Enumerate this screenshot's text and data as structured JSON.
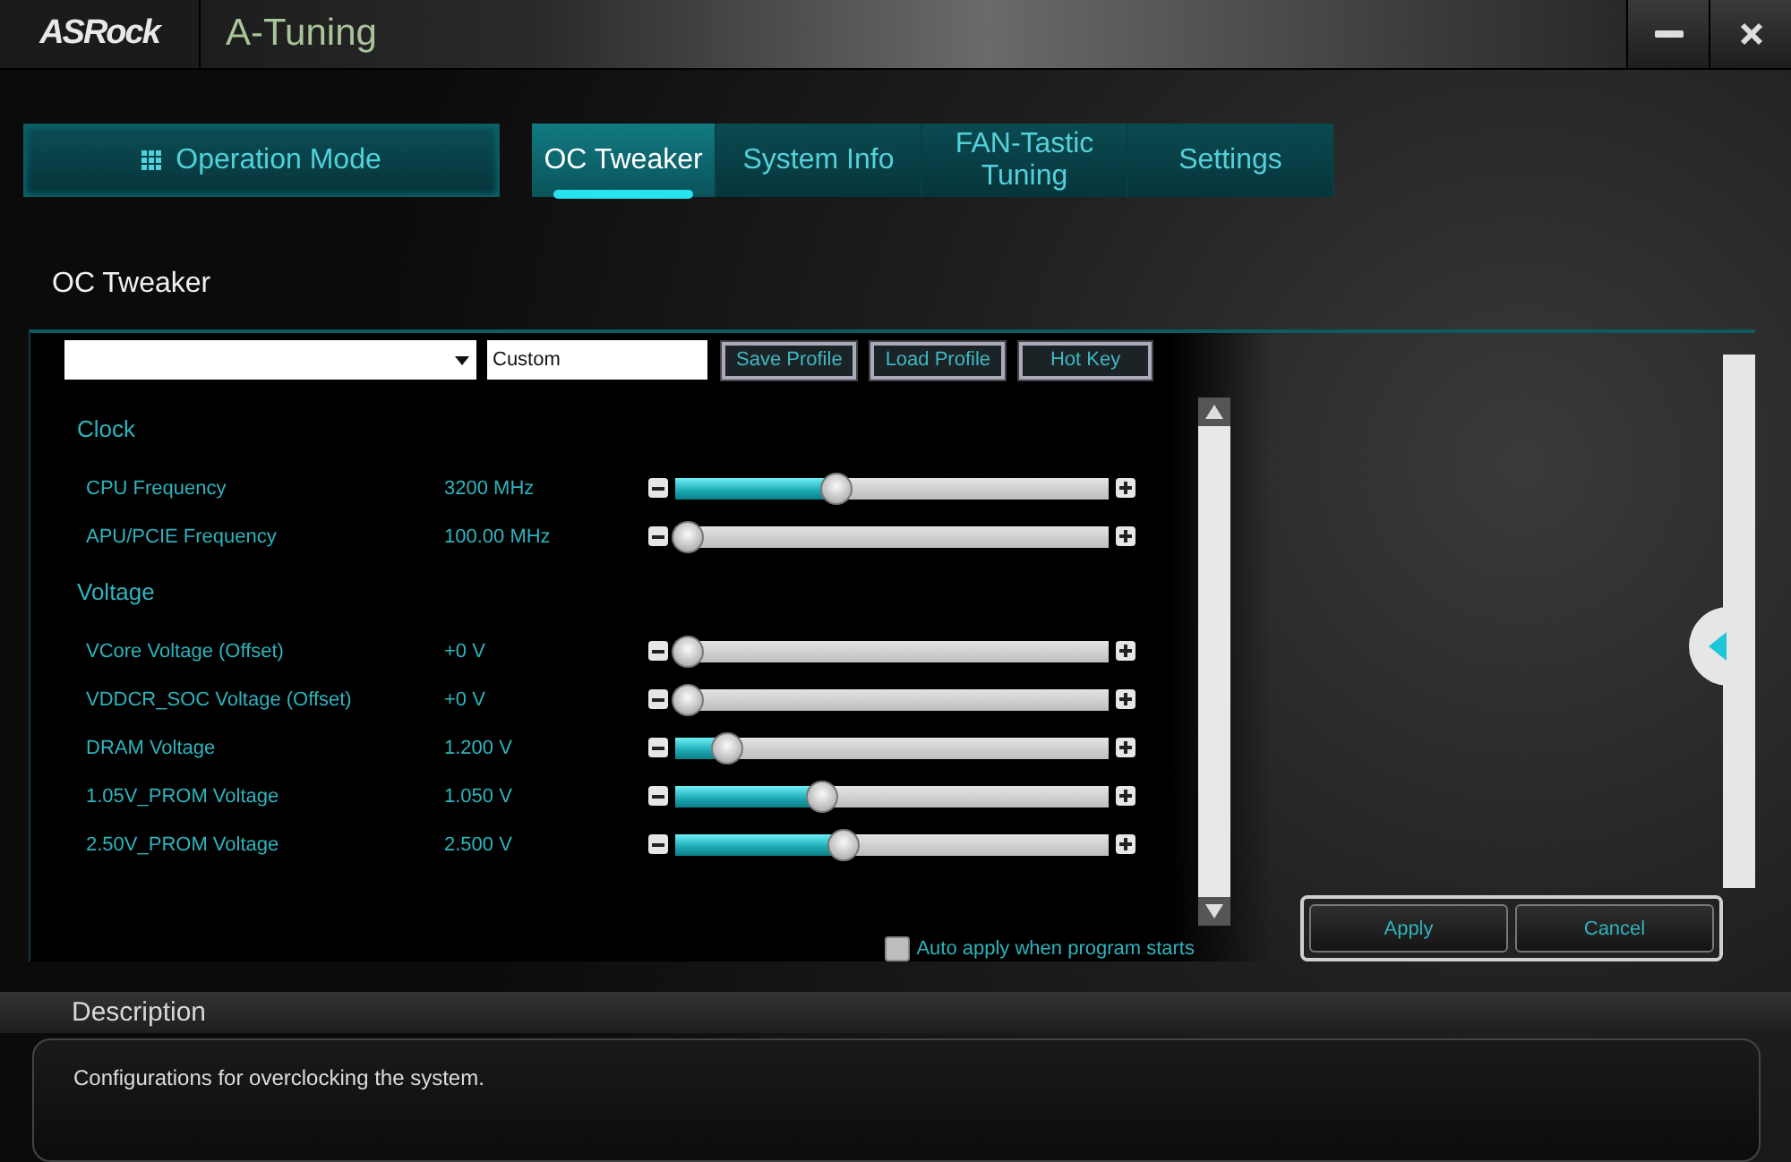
{
  "window": {
    "logo": "ASRock",
    "title": "A-Tuning"
  },
  "mode_button": {
    "label": "Operation Mode"
  },
  "tabs": [
    {
      "label": "OC Tweaker",
      "selected": true
    },
    {
      "label": "System Info",
      "selected": false
    },
    {
      "label": "FAN-Tastic Tuning",
      "selected": false
    },
    {
      "label": "Settings",
      "selected": false
    }
  ],
  "page_title": "OC Tweaker",
  "profile": {
    "name": "Custom",
    "buttons": [
      "Save Profile",
      "Load Profile",
      "Hot Key"
    ]
  },
  "sections": [
    {
      "title": "Clock",
      "settings": [
        {
          "name": "CPU Frequency",
          "reading": "3200 MHz",
          "level": 0.37
        },
        {
          "name": "APU/PCIE Frequency",
          "reading": "100.00 MHz",
          "level": 0.03
        }
      ]
    },
    {
      "title": "Voltage",
      "settings": [
        {
          "name": "VCore Voltage (Offset)",
          "reading": "+0 V",
          "level": 0.03
        },
        {
          "name": "VDDCR_SOC Voltage (Offset)",
          "reading": "+0 V",
          "level": 0.03
        },
        {
          "name": "DRAM Voltage",
          "reading": "1.200 V",
          "level": 0.12
        },
        {
          "name": "1.05V_PROM Voltage",
          "reading": "1.050 V",
          "level": 0.34
        },
        {
          "name": "2.50V_PROM Voltage",
          "reading": "2.500 V",
          "level": 0.39
        }
      ]
    }
  ],
  "auto_apply": {
    "label": "Auto apply when program starts",
    "checked": false
  },
  "actions": [
    "Apply",
    "Cancel"
  ],
  "description": {
    "title": "Description",
    "text": "Configurations for overclocking the system."
  }
}
